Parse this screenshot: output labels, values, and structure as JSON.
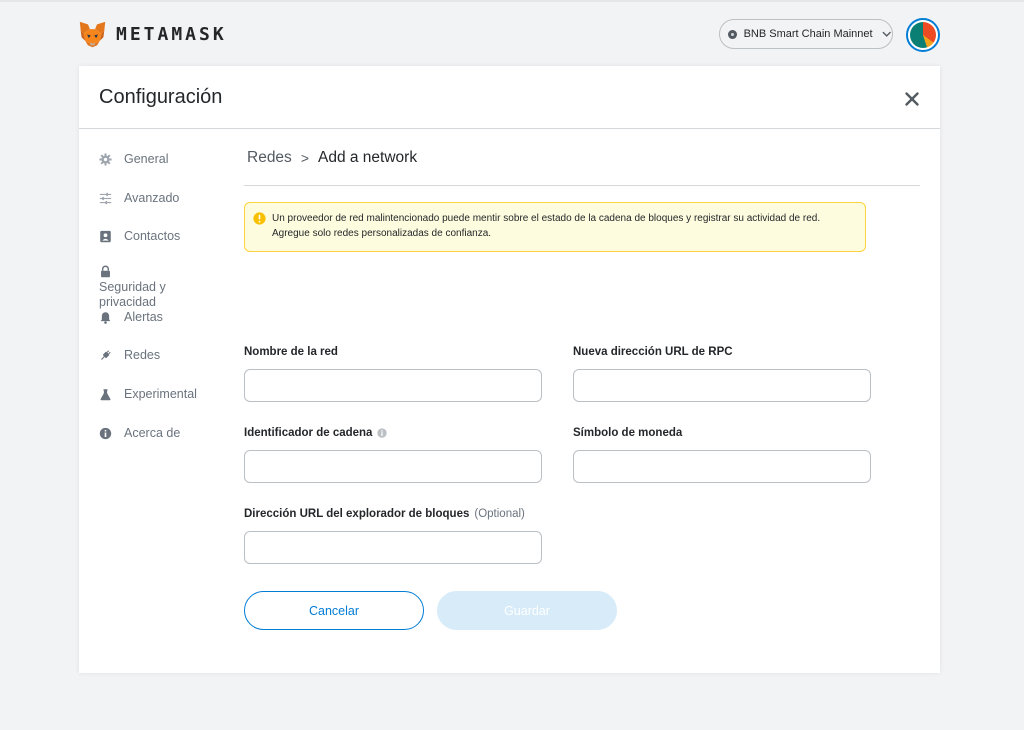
{
  "app": {
    "brand": "METAMASK"
  },
  "network": {
    "label": "BNB Smart Chain Mainnet"
  },
  "settings": {
    "title": "Configuración",
    "sidebar": [
      {
        "label": "General",
        "icon": "gear-icon"
      },
      {
        "label": "Avanzado",
        "icon": "sliders-icon"
      },
      {
        "label": "Contactos",
        "icon": "contacts-icon"
      },
      {
        "label": "Seguridad y privacidad",
        "icon": "lock-icon"
      },
      {
        "label": "Alertas",
        "icon": "bell-icon"
      },
      {
        "label": "Redes",
        "icon": "plug-icon"
      },
      {
        "label": "Experimental",
        "icon": "flask-icon"
      },
      {
        "label": "Acerca de",
        "icon": "info-icon"
      }
    ]
  },
  "breadcrumb": {
    "parent": "Redes",
    "separator": ">",
    "current": "Add a network"
  },
  "warning": {
    "text": "Un proveedor de red malintencionado puede mentir sobre el estado de la cadena de bloques y registrar su actividad de red. Agregue solo redes personalizadas de confianza."
  },
  "form": {
    "network_name": {
      "label": "Nombre de la red",
      "value": ""
    },
    "rpc_url": {
      "label": "Nueva dirección URL de RPC",
      "value": ""
    },
    "chain_id": {
      "label": "Identificador de cadena",
      "value": ""
    },
    "currency_symbol": {
      "label": "Símbolo de moneda",
      "value": ""
    },
    "explorer_url": {
      "label": "Dirección URL del explorador de bloques",
      "optional": "(Optional)",
      "value": ""
    }
  },
  "buttons": {
    "cancel": "Cancelar",
    "save": "Guardar"
  },
  "colors": {
    "accent": "#037dd6",
    "warning_bg": "#fefcde",
    "warning_border": "#ffd33d",
    "disabled_button": "#d7ebf9"
  }
}
